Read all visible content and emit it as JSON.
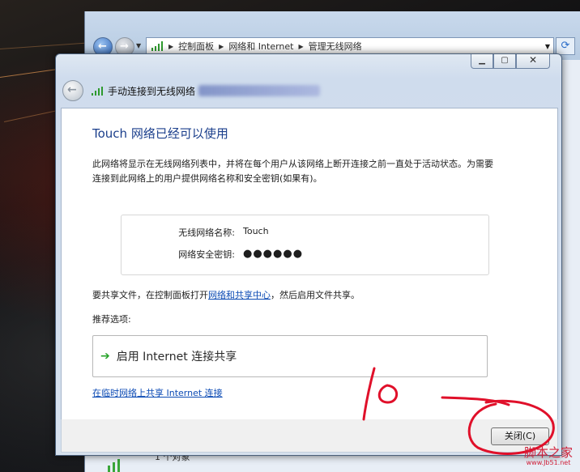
{
  "background_window": {
    "breadcrumb": [
      "控制面板",
      "网络和 Internet",
      "管理无线网络"
    ],
    "status_text": "1 个对象"
  },
  "dialog": {
    "title": "手动连接到无线网络",
    "heading": "Touch 网络已经可以使用",
    "description": "此网络将显示在无线网络列表中，并将在每个用户从该网络上断开连接之前一直处于活动状态。为需要连接到此网络上的用户提供网络名称和安全密钥(如果有)。",
    "network_name_label": "无线网络名称:",
    "network_name_value": "Touch",
    "security_key_label": "网络安全密钥:",
    "security_key_value": "●●●●●●",
    "share_prefix": "要共享文件，在控制面板打开",
    "share_link": "网络和共享中心",
    "share_suffix": "，然后启用文件共享。",
    "recommended_label": "推荐选项:",
    "option_label": "启用 Internet 连接共享",
    "adhoc_link": "在临时网络上共享 Internet 连接",
    "close_button": "关闭(C)"
  },
  "annotation": {
    "watermark_main": "脚本之家",
    "watermark_sub": "www.Jb51.net"
  },
  "colors": {
    "heading": "#1b3f8c",
    "link": "#0b4ab4",
    "annotation": "#e0102a"
  }
}
